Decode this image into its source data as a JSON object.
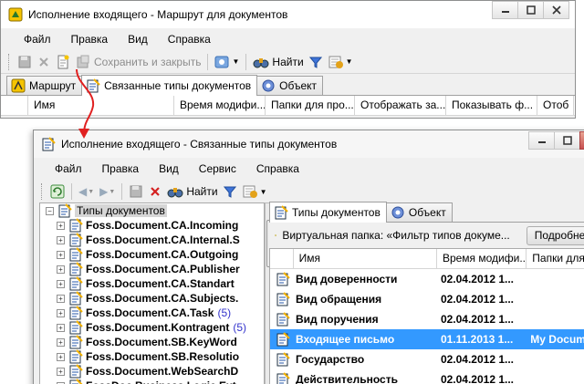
{
  "colors": {
    "accent": "#3399ff",
    "arrow": "#e02020",
    "count": "#3333cc"
  },
  "winA": {
    "title": "Исполнение входящего - Маршрут для документов",
    "menu": [
      "Файл",
      "Правка",
      "Вид",
      "Справка"
    ],
    "toolbar": {
      "save_close": "Сохранить и закрыть",
      "find": "Найти"
    },
    "tabs": [
      "Маршрут",
      "Связанные типы документов",
      "Объект"
    ],
    "columns": [
      "Имя",
      "Время модифи...",
      "Папки для про...",
      "Отображать за...",
      "Показывать ф...",
      "Отоб"
    ]
  },
  "winB": {
    "title": "Исполнение входящего - Связанные типы документов",
    "menu": [
      "Файл",
      "Правка",
      "Вид",
      "Сервис",
      "Справка"
    ],
    "toolbar": {
      "find": "Найти"
    },
    "tree": {
      "root": "Типы документов",
      "items": [
        {
          "label": "Foss.Document.CA.Incoming",
          "count": ""
        },
        {
          "label": "Foss.Document.CA.Internal.S",
          "count": ""
        },
        {
          "label": "Foss.Document.CA.Outgoing",
          "count": ""
        },
        {
          "label": "Foss.Document.CA.Publisher",
          "count": ""
        },
        {
          "label": "Foss.Document.CA.Standart",
          "count": ""
        },
        {
          "label": "Foss.Document.CA.Subjects.",
          "count": ""
        },
        {
          "label": "Foss.Document.CA.Task",
          "count": "(5)"
        },
        {
          "label": "Foss.Document.Kontragent",
          "count": "(5)"
        },
        {
          "label": "Foss.Document.SB.KeyWord",
          "count": ""
        },
        {
          "label": "Foss.Document.SB.Resolutio",
          "count": ""
        },
        {
          "label": "Foss.Document.WebSearchD",
          "count": ""
        },
        {
          "label": "FossDoc.Business.Logic.Ext",
          "count": ""
        }
      ]
    },
    "tabs": [
      "Типы документов",
      "Объект"
    ],
    "virtual_folder": "Виртуальная папка: «Фильтр типов докуме...",
    "details_button": "Подробнее",
    "columns": [
      "Имя",
      "Время модифи...",
      "Папки для"
    ],
    "rows": [
      {
        "name": "Вид доверенности",
        "date": "02.04.2012 1...",
        "folder": ""
      },
      {
        "name": "Вид обращения",
        "date": "02.04.2012 1...",
        "folder": ""
      },
      {
        "name": "Вид поручения",
        "date": "02.04.2012 1...",
        "folder": ""
      },
      {
        "name": "Входящее письмо",
        "date": "01.11.2013 1...",
        "folder": "My Docum"
      },
      {
        "name": "Государство",
        "date": "02.04.2012 1...",
        "folder": ""
      },
      {
        "name": "Действительность",
        "date": "02.04.2012 1...",
        "folder": ""
      }
    ],
    "selected_row": 3
  }
}
